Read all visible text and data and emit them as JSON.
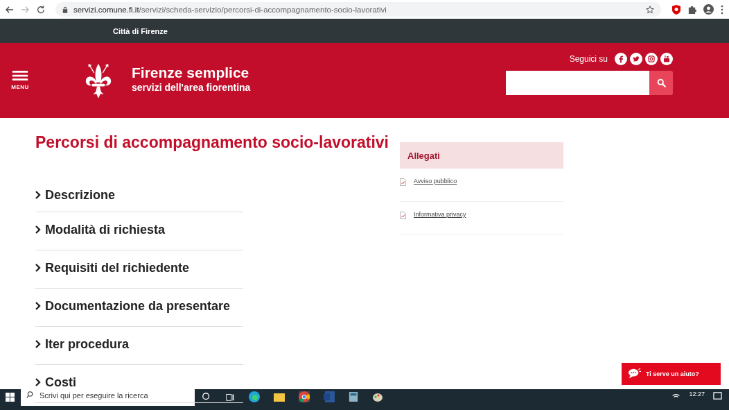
{
  "browser": {
    "url_host": "servizi.comune.fi.it",
    "url_path": "/servizi/scheda-servizio/percorsi-di-accompagnamento-socio-lavorativi"
  },
  "top_bar": {
    "title": "Città di Firenze"
  },
  "header": {
    "menu_label": "MENU",
    "site_title": "Firenze semplice",
    "site_subtitle": "servizi dell'area fiorentina",
    "follow_label": "Seguici su",
    "socials": [
      {
        "kind": "facebook"
      },
      {
        "kind": "twitter"
      },
      {
        "kind": "instagram"
      },
      {
        "kind": "youtube"
      }
    ]
  },
  "page": {
    "title": "Percorsi di accompagnamento socio-lavorativi",
    "sections": [
      {
        "label": "Descrizione",
        "expanded": false
      },
      {
        "label": "Modalità di richiesta",
        "expanded": false
      },
      {
        "label": "Requisiti del richiedente",
        "expanded": false
      },
      {
        "label": "Documentazione da presentare",
        "expanded": false
      },
      {
        "label": "Iter procedura",
        "expanded": false
      },
      {
        "label": "Costi",
        "expanded": false
      }
    ],
    "attachments": {
      "title": "Allegati",
      "items": [
        {
          "label": "Avviso pubblico"
        },
        {
          "label": "Informativa privacy"
        }
      ]
    }
  },
  "help_button": {
    "label": "Ti serve un aiuto?"
  },
  "taskbar": {
    "search_placeholder": "Scrivi qui per eseguire la ricerca",
    "time": "12:27"
  }
}
